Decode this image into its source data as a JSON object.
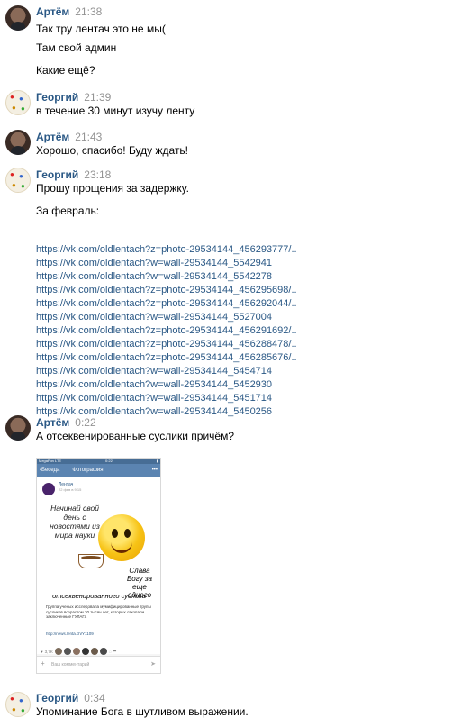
{
  "messages": [
    {
      "author": "Артём",
      "time": "21:38",
      "lines": [
        "Так тру лентач это не мы(",
        "Там свой админ",
        "Какие ещё?"
      ]
    },
    {
      "author": "Георгий",
      "time": "21:39",
      "lines": [
        "в течение 30 минут изучу ленту"
      ]
    },
    {
      "author": "Артём",
      "time": "21:43",
      "lines": [
        "Хорошо, спасибо! Буду ждать!"
      ]
    },
    {
      "author": "Георгий",
      "time": "23:18",
      "lines": [
        "Прошу прощения за задержку.",
        "За февраль:"
      ],
      "links": [
        "https://vk.com/oldlentach?z=photo-29534144_456293777/..",
        "https://vk.com/oldlentach?w=wall-29534144_5542941",
        "https://vk.com/oldlentach?w=wall-29534144_5542278",
        "https://vk.com/oldlentach?z=photo-29534144_456295698/..",
        "https://vk.com/oldlentach?z=photo-29534144_456292044/..",
        "https://vk.com/oldlentach?w=wall-29534144_5527004",
        "https://vk.com/oldlentach?z=photo-29534144_456291692/..",
        "https://vk.com/oldlentach?z=photo-29534144_456288478/..",
        "https://vk.com/oldlentach?z=photo-29534144_456285676/..",
        "https://vk.com/oldlentach?w=wall-29534144_5454714",
        "https://vk.com/oldlentach?w=wall-29534144_5452930",
        "https://vk.com/oldlentach?w=wall-29534144_5451714",
        "https://vk.com/oldlentach?w=wall-29534144_5450256"
      ]
    },
    {
      "author": "Артём",
      "time": "0:22",
      "lines": [
        "А отсеквенированные суслики причём?"
      ]
    },
    {
      "author": "Георгий",
      "time": "0:34",
      "lines": [
        "Упоминание Бога в шутливом выражении."
      ]
    }
  ],
  "photo": {
    "status_carrier": "MegaFon LTE",
    "status_time": "0:22",
    "nav_back": "Беседа",
    "nav_title": "Фотография",
    "nav_more": "•••",
    "source_name": "Лентач",
    "source_date": "22 фев в 9:15",
    "text_top": "Начинай свой день с новостями из мира науки",
    "text_right": "Слава Богу за еще одного",
    "text_bottom": "отсеквенированного суслика",
    "description": "Группа ученых исследовала мумифицированные трупы сусликов возрастом 30 тысяч лет, которых откопали заключенные ГУЛАГа",
    "url": "http://news.lenta.ch/Y1109",
    "likes": "3,7K",
    "comment_placeholder": "Ваш комментарий"
  }
}
